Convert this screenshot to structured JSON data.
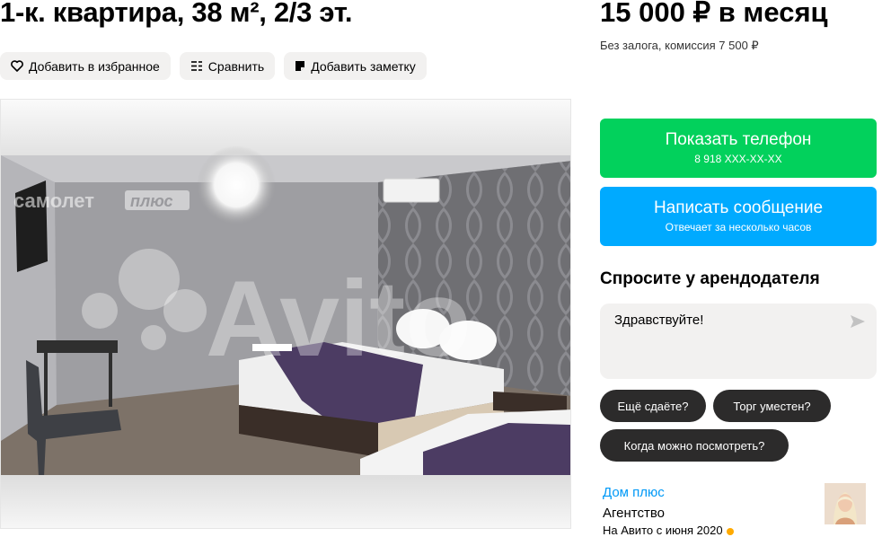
{
  "listing": {
    "title": "1-к. квартира, 38 м², 2/3 эт.",
    "price": "15 000 ₽ в месяц",
    "price_note": "Без залога, комиссия 7 500 ₽"
  },
  "actions": {
    "favorite": "Добавить в избранное",
    "compare": "Сравнить",
    "note": "Добавить заметку"
  },
  "gallery": {
    "watermark_brand": "самолет",
    "watermark_badge": "плюс",
    "watermark_site": "Avito"
  },
  "contact": {
    "show_phone": "Показать телефон",
    "phone_masked": "8 918 XXX-XX-XX",
    "write_message": "Написать сообщение",
    "reply_time": "Отвечает за несколько часов"
  },
  "ask": {
    "title": "Спросите у арендодателя",
    "message": "Здравствуйте!",
    "quick_replies": [
      "Ещё сдаёте?",
      "Торг уместен?",
      "Когда можно посмотреть?"
    ]
  },
  "seller": {
    "name": "Дом плюс",
    "type": "Агентство",
    "since": "На Авито с июня 2020"
  },
  "colors": {
    "call_button": "#02d15c",
    "message_button": "#00aaff",
    "chip": "#2c2b2b",
    "link": "#0099f7"
  },
  "icons": [
    "heart-icon",
    "compare-icon",
    "note-icon",
    "send-icon"
  ]
}
